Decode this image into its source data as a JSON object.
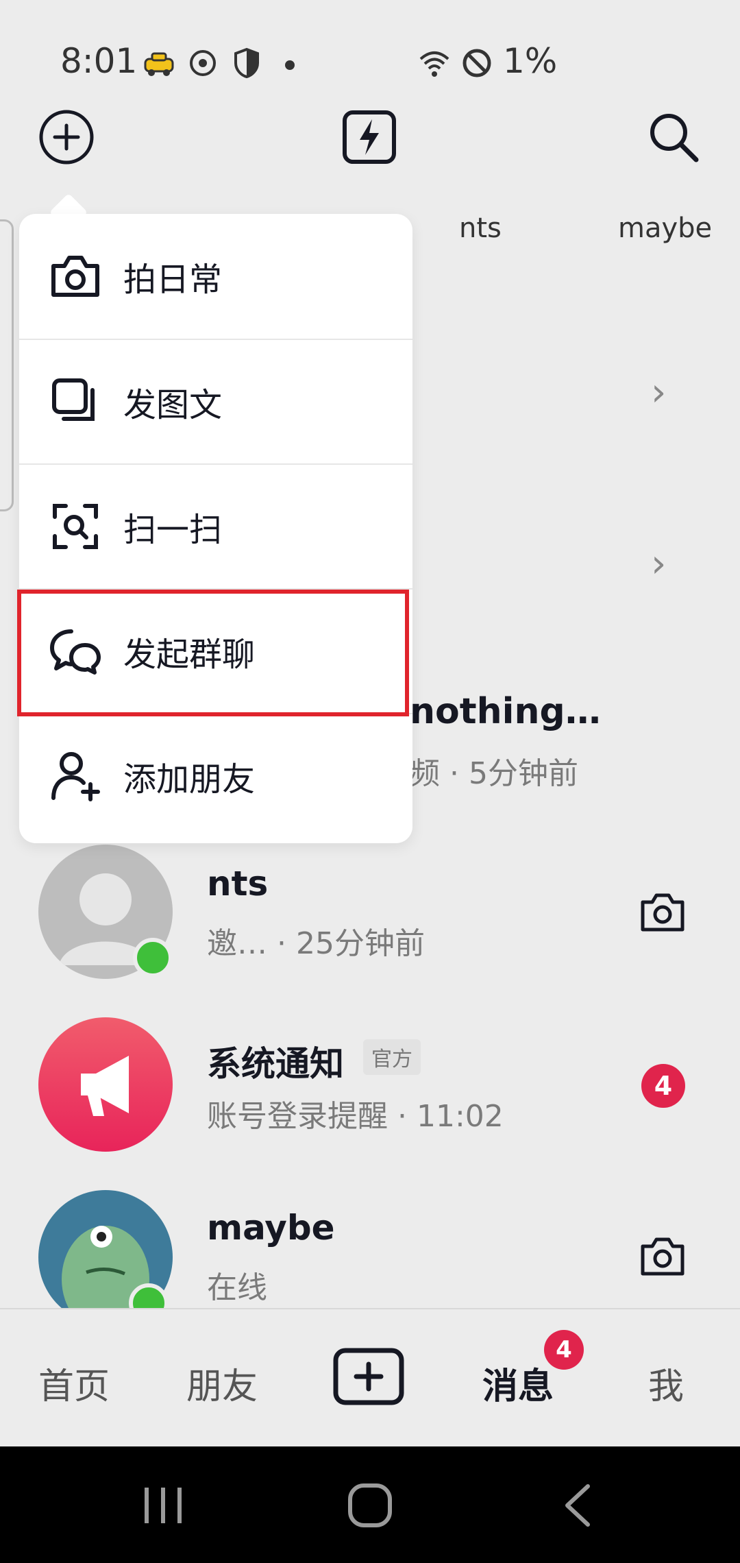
{
  "status_bar": {
    "time": "8:01",
    "battery": "1%"
  },
  "header": {
    "add_icon": "plus-circle-icon",
    "flash_icon": "lightning-icon",
    "search_icon": "search-icon"
  },
  "top_tabs": [
    "nts",
    "maybe"
  ],
  "menu": {
    "items": [
      {
        "label": "拍日常",
        "icon": "camera-icon"
      },
      {
        "label": "发图文",
        "icon": "gallery-icon"
      },
      {
        "label": "扫一扫",
        "icon": "scan-icon"
      },
      {
        "label": "发起群聊",
        "icon": "group-chat-icon"
      },
      {
        "label": "添加朋友",
        "icon": "add-friend-icon"
      }
    ]
  },
  "behind_row": {
    "title": "nothing…",
    "subtitle": "频 · 5分钟前"
  },
  "conversations": [
    {
      "name": "nts",
      "subtitle": "邀…   · 25分钟前",
      "action_icon": "camera-icon"
    },
    {
      "name": "系统通知",
      "tag": "官方",
      "subtitle": "账号登录提醒 · 11:02",
      "badge": "4"
    },
    {
      "name": "maybe",
      "subtitle": "在线",
      "action_icon": "camera-icon"
    }
  ],
  "bottom_nav": {
    "home": "首页",
    "friends": "朋友",
    "messages": "消息",
    "messages_badge": "4",
    "me": "我"
  },
  "colors": {
    "accent": "#e0242c",
    "badge": "#e0244c",
    "online": "#3fbf3a"
  }
}
